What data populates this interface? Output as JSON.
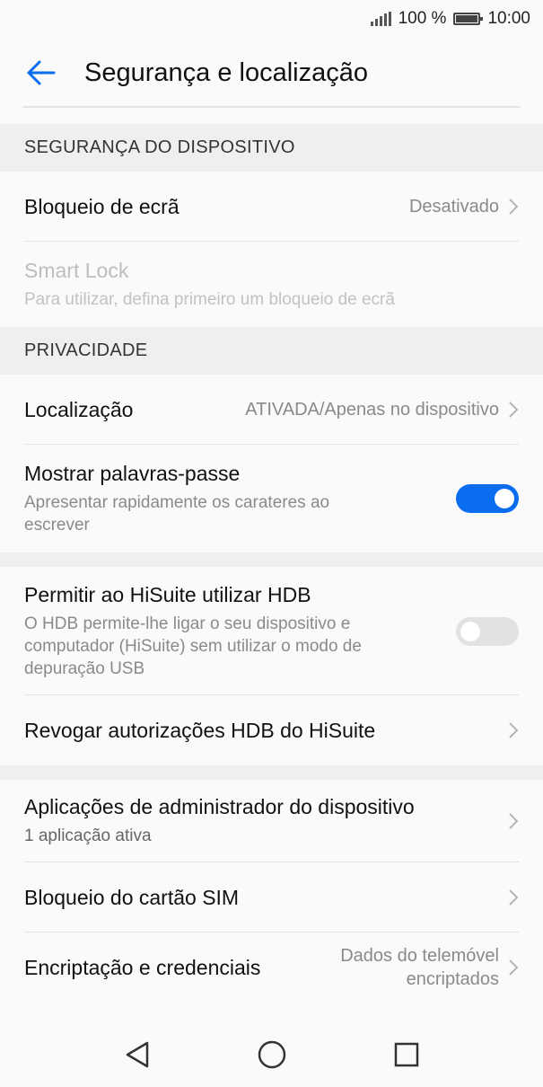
{
  "status_bar": {
    "battery_percent": "100 %",
    "time": "10:00"
  },
  "header": {
    "title": "Segurança e localização"
  },
  "sections": {
    "device_security": {
      "label": "SEGURANÇA DO DISPOSITIVO"
    },
    "privacy": {
      "label": "PRIVACIDADE"
    }
  },
  "rows": {
    "screen_lock": {
      "title": "Bloqueio de ecrã",
      "value": "Desativado"
    },
    "smart_lock": {
      "title": "Smart Lock",
      "subtitle": "Para utilizar, defina primeiro um bloqueio de ecrã"
    },
    "location": {
      "title": "Localização",
      "value": "ATIVADA/Apenas no dispositivo"
    },
    "show_passwords": {
      "title": "Mostrar palavras-passe",
      "subtitle_line1": "Apresentar rapidamente os carateres ao",
      "subtitle_line2": "escrever",
      "enabled": true
    },
    "hisuite_hdb": {
      "title": "Permitir ao HiSuite utilizar HDB",
      "subtitle_line1": "O HDB permite-lhe ligar o seu dispositivo e",
      "subtitle_line2": "computador (HiSuite) sem utilizar o modo de",
      "subtitle_line3": "depuração USB",
      "enabled": false
    },
    "revoke_hdb": {
      "title": "Revogar autorizações HDB do HiSuite"
    },
    "device_admin": {
      "title": "Aplicações de administrador do dispositivo",
      "subtitle": "1 aplicação ativa"
    },
    "sim_lock": {
      "title": "Bloqueio do cartão SIM"
    },
    "encryption": {
      "title": "Encriptação e credenciais",
      "value_line1": "Dados do telemóvel",
      "value_line2": "encriptados"
    }
  },
  "colors": {
    "accent": "#0a6df0",
    "toggle_off": "#e2e2e2",
    "section_bg": "#efefef"
  },
  "icons": {
    "back": "arrow-left-icon",
    "chevron": "chevron-right-icon",
    "nav_back": "triangle-back-icon",
    "nav_home": "circle-home-icon",
    "nav_recents": "square-recents-icon"
  }
}
